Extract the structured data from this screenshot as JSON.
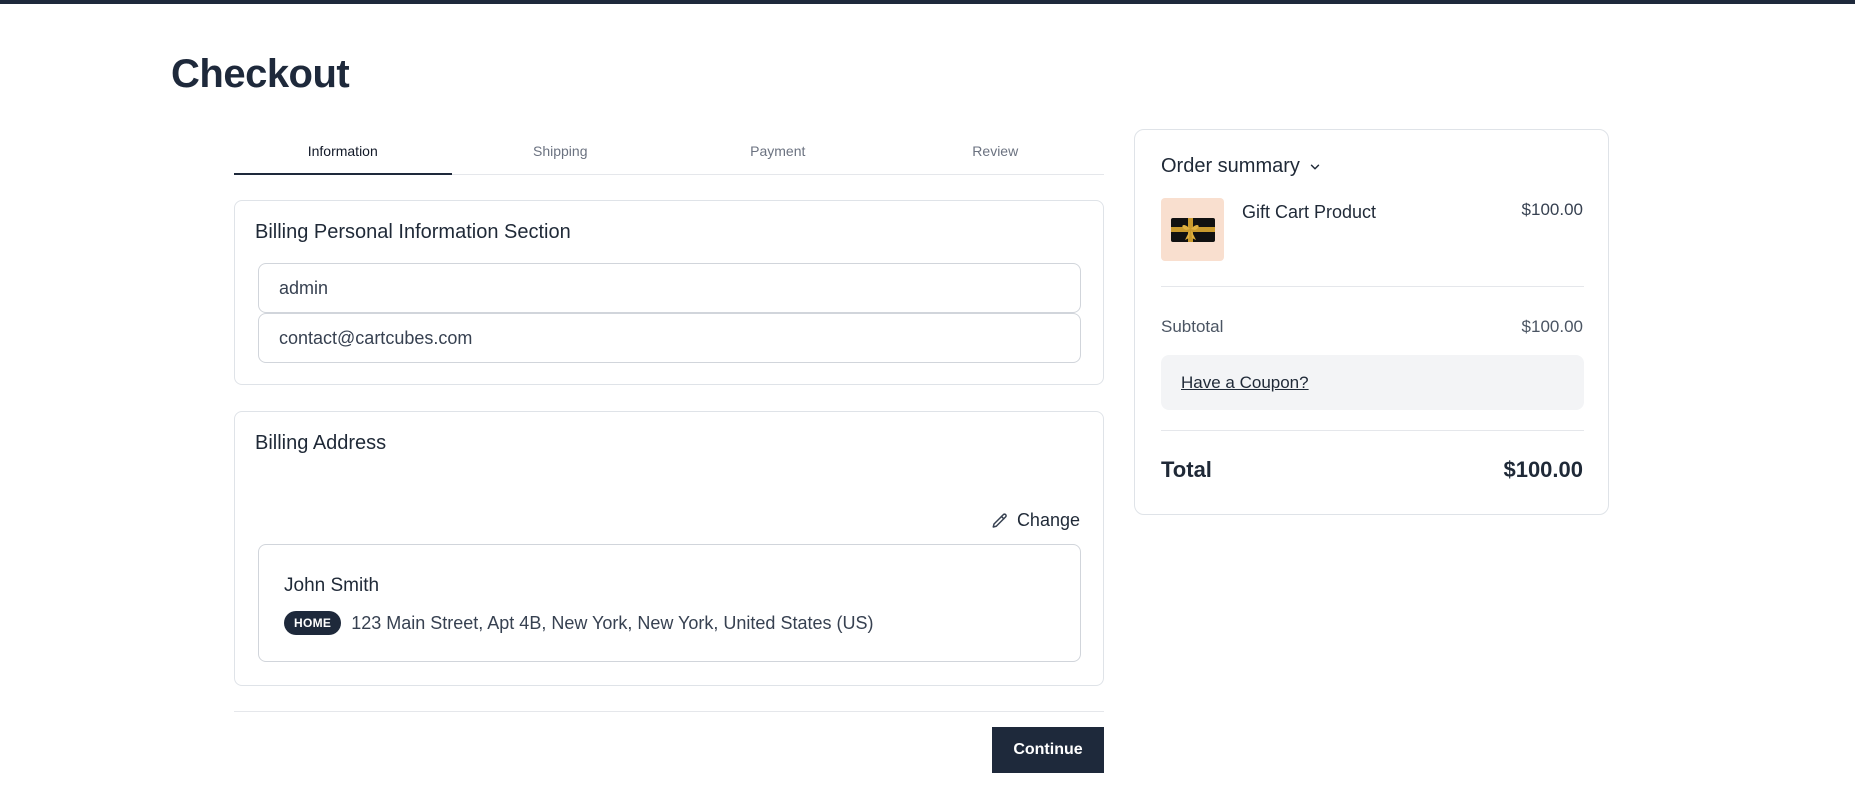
{
  "page": {
    "title": "Checkout"
  },
  "tabs": [
    {
      "label": "Information",
      "active": true
    },
    {
      "label": "Shipping",
      "active": false
    },
    {
      "label": "Payment",
      "active": false
    },
    {
      "label": "Review",
      "active": false
    }
  ],
  "personal_info": {
    "title": "Billing Personal Information Section",
    "name_value": "admin",
    "email_value": "contact@cartcubes.com"
  },
  "billing_address": {
    "title": "Billing Address",
    "change_label": "Change",
    "name": "John Smith",
    "badge": "HOME",
    "address": "123 Main Street, Apt 4B, New York, New York, United States (US)"
  },
  "actions": {
    "continue_label": "Continue"
  },
  "summary": {
    "title": "Order summary",
    "product": {
      "name": "Gift Cart Product",
      "price": "$100.00",
      "thumb_icon": "gift-card-icon"
    },
    "subtotal_label": "Subtotal",
    "subtotal_value": "$100.00",
    "coupon_label": "Have a Coupon?",
    "total_label": "Total",
    "total_value": "$100.00"
  },
  "colors": {
    "primary": "#1e293b",
    "border": "#dfe3e8",
    "coupon_bg": "#f3f4f6",
    "thumb_bg": "#f9dfcf"
  }
}
